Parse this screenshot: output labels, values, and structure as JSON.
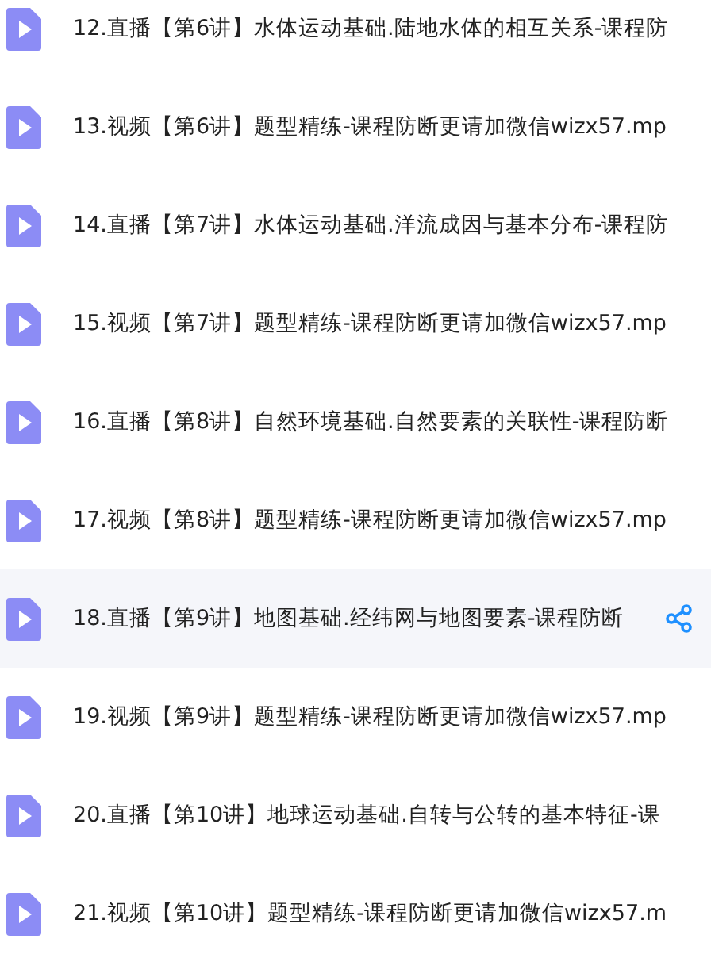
{
  "files": [
    {
      "name": "12.直播【第6讲】水体运动基础.陆地水体的相互关系-课程防",
      "selected": false
    },
    {
      "name": "13.视频【第6讲】题型精练-课程防断更请加微信wizx57.mp",
      "selected": false
    },
    {
      "name": "14.直播【第7讲】水体运动基础.洋流成因与基本分布-课程防",
      "selected": false
    },
    {
      "name": "15.视频【第7讲】题型精练-课程防断更请加微信wizx57.mp",
      "selected": false
    },
    {
      "name": "16.直播【第8讲】自然环境基础.自然要素的关联性-课程防断",
      "selected": false
    },
    {
      "name": "17.视频【第8讲】题型精练-课程防断更请加微信wizx57.mp",
      "selected": false
    },
    {
      "name": "18.直播【第9讲】地图基础.经纬网与地图要素-课程防断",
      "selected": true
    },
    {
      "name": "19.视频【第9讲】题型精练-课程防断更请加微信wizx57.mp",
      "selected": false
    },
    {
      "name": "20.直播【第10讲】地球运动基础.自转与公转的基本特征-课",
      "selected": false
    },
    {
      "name": "21.视频【第10讲】题型精练-课程防断更请加微信wizx57.m",
      "selected": false
    }
  ]
}
